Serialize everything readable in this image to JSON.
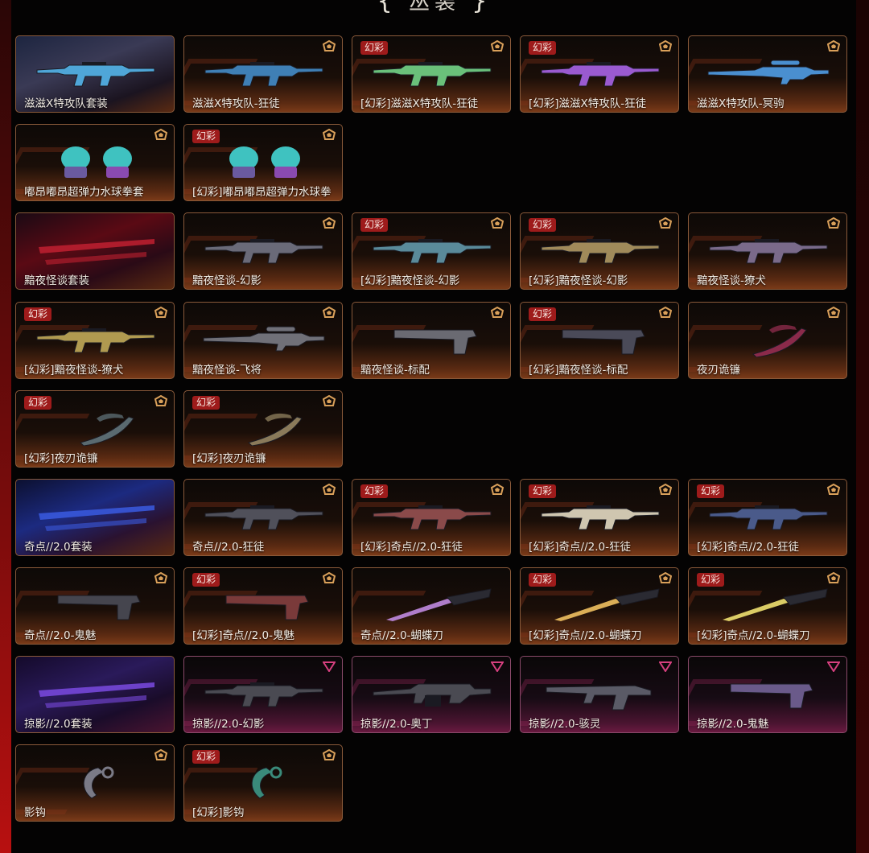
{
  "header": {
    "title": "丛装",
    "bracket_left": "{",
    "bracket_right": "}"
  },
  "colors": {
    "gold_tier": "#d9a05a",
    "purple_tier": "#d6407f",
    "badge_bg": "#9e1b1b",
    "label_text": "#f2ece4"
  },
  "items": [
    {
      "label": "滋滋X特攻队套装",
      "badge": "",
      "tier": "none",
      "kind": "bundle-blue-light",
      "weapon": "rifle",
      "row": 0,
      "col": 0,
      "weapon_color": "#4fa6d8"
    },
    {
      "label": "滋滋X特攻队-狂徒",
      "badge": "",
      "tier": "gold",
      "kind": "normal",
      "weapon": "rifle",
      "row": 0,
      "col": 1,
      "weapon_color": "#3f7fb5"
    },
    {
      "label": "[幻彩]滋滋X特攻队-狂徒",
      "badge": "幻彩",
      "tier": "gold",
      "kind": "normal",
      "weapon": "rifle",
      "row": 0,
      "col": 2,
      "weapon_color": "#6ac07a"
    },
    {
      "label": "[幻彩]滋滋X特攻队-狂徒",
      "badge": "幻彩",
      "tier": "gold",
      "kind": "normal",
      "weapon": "rifle",
      "row": 0,
      "col": 3,
      "weapon_color": "#9a5ad0"
    },
    {
      "label": "滋滋X特攻队-冥驹",
      "badge": "",
      "tier": "gold",
      "kind": "normal",
      "weapon": "sniper",
      "row": 0,
      "col": 4,
      "weapon_color": "#4a8fd0"
    },
    {
      "label": "嘟昂嘟昂超弹力水球拳套",
      "badge": "",
      "tier": "gold",
      "kind": "normal",
      "weapon": "gloves",
      "row": 1,
      "col": 0,
      "weapon_color": "#3fc2c0"
    },
    {
      "label": "[幻彩]嘟昂嘟昂超弹力水球拳",
      "badge": "幻彩",
      "tier": "gold",
      "kind": "normal",
      "weapon": "gloves",
      "row": 1,
      "col": 1,
      "weapon_color": "#3fc2c0"
    },
    {
      "label": "黯夜怪谈套装",
      "badge": "",
      "tier": "none",
      "kind": "bundle-red",
      "weapon": "bundle",
      "row": 2,
      "col": 0,
      "weapon_color": "#c02030"
    },
    {
      "label": "黯夜怪谈-幻影",
      "badge": "",
      "tier": "gold",
      "kind": "normal",
      "weapon": "rifle",
      "row": 2,
      "col": 1,
      "weapon_color": "#6a6a78"
    },
    {
      "label": "[幻彩]黯夜怪谈-幻影",
      "badge": "幻彩",
      "tier": "gold",
      "kind": "normal",
      "weapon": "rifle",
      "row": 2,
      "col": 2,
      "weapon_color": "#5a8a9a"
    },
    {
      "label": "[幻彩]黯夜怪谈-幻影",
      "badge": "幻彩",
      "tier": "gold",
      "kind": "normal",
      "weapon": "rifle",
      "row": 2,
      "col": 3,
      "weapon_color": "#a08a5a"
    },
    {
      "label": "黯夜怪谈-獠犬",
      "badge": "",
      "tier": "gold",
      "kind": "normal",
      "weapon": "rifle",
      "row": 2,
      "col": 4,
      "weapon_color": "#7a6a8a"
    },
    {
      "label": "[幻彩]黯夜怪谈-獠犬",
      "badge": "幻彩",
      "tier": "gold",
      "kind": "normal",
      "weapon": "rifle",
      "row": 3,
      "col": 0,
      "weapon_color": "#b09a50"
    },
    {
      "label": "黯夜怪谈-飞将",
      "badge": "",
      "tier": "gold",
      "kind": "normal",
      "weapon": "sniper",
      "row": 3,
      "col": 1,
      "weapon_color": "#707078"
    },
    {
      "label": "黯夜怪谈-标配",
      "badge": "",
      "tier": "gold",
      "kind": "normal",
      "weapon": "pistol",
      "row": 3,
      "col": 2,
      "weapon_color": "#6a6a72"
    },
    {
      "label": "[幻彩]黯夜怪谈-标配",
      "badge": "幻彩",
      "tier": "gold",
      "kind": "normal",
      "weapon": "pistol",
      "row": 3,
      "col": 3,
      "weapon_color": "#4a4a58"
    },
    {
      "label": "夜刃诡镰",
      "badge": "",
      "tier": "gold",
      "kind": "normal",
      "weapon": "scythe",
      "row": 3,
      "col": 4,
      "weapon_color": "#8a2a4a"
    },
    {
      "label": "[幻彩]夜刃诡镰",
      "badge": "幻彩",
      "tier": "gold",
      "kind": "normal",
      "weapon": "scythe",
      "row": 4,
      "col": 0,
      "weapon_color": "#5a6a70"
    },
    {
      "label": "[幻彩]夜刃诡镰",
      "badge": "幻彩",
      "tier": "gold",
      "kind": "normal",
      "weapon": "scythe",
      "row": 4,
      "col": 1,
      "weapon_color": "#8a7a5a"
    },
    {
      "label": "奇点//2.0套装",
      "badge": "",
      "tier": "none",
      "kind": "bundle-blue",
      "weapon": "bundle",
      "row": 5,
      "col": 0,
      "weapon_color": "#3a5ae0"
    },
    {
      "label": "奇点//2.0-狂徒",
      "badge": "",
      "tier": "gold",
      "kind": "normal",
      "weapon": "rifle",
      "row": 5,
      "col": 1,
      "weapon_color": "#50505a"
    },
    {
      "label": "[幻彩]奇点//2.0-狂徒",
      "badge": "幻彩",
      "tier": "gold",
      "kind": "normal",
      "weapon": "rifle",
      "row": 5,
      "col": 2,
      "weapon_color": "#8a4a4a"
    },
    {
      "label": "[幻彩]奇点//2.0-狂徒",
      "badge": "幻彩",
      "tier": "gold",
      "kind": "normal",
      "weapon": "rifle",
      "row": 5,
      "col": 3,
      "weapon_color": "#cfc6b0"
    },
    {
      "label": "[幻彩]奇点//2.0-狂徒",
      "badge": "幻彩",
      "tier": "gold",
      "kind": "normal",
      "weapon": "rifle",
      "row": 5,
      "col": 4,
      "weapon_color": "#4a5a8a"
    },
    {
      "label": "奇点//2.0-鬼魅",
      "badge": "",
      "tier": "gold",
      "kind": "normal",
      "weapon": "pistol",
      "row": 6,
      "col": 0,
      "weapon_color": "#45454e"
    },
    {
      "label": "[幻彩]奇点//2.0-鬼魅",
      "badge": "幻彩",
      "tier": "gold",
      "kind": "normal",
      "weapon": "pistol",
      "row": 6,
      "col": 1,
      "weapon_color": "#7a3a3a"
    },
    {
      "label": "奇点//2.0-蝴蝶刀",
      "badge": "",
      "tier": "none",
      "kind": "normal",
      "weapon": "knife",
      "row": 6,
      "col": 2,
      "weapon_color": "#c08ae0"
    },
    {
      "label": "[幻彩]奇点//2.0-蝴蝶刀",
      "badge": "幻彩",
      "tier": "gold",
      "kind": "normal",
      "weapon": "knife",
      "row": 6,
      "col": 3,
      "weapon_color": "#f0c060"
    },
    {
      "label": "[幻彩]奇点//2.0-蝴蝶刀",
      "badge": "幻彩",
      "tier": "gold",
      "kind": "normal",
      "weapon": "knife",
      "row": 6,
      "col": 4,
      "weapon_color": "#f0e070"
    },
    {
      "label": "掠影//2.0套装",
      "badge": "",
      "tier": "none",
      "kind": "bundle-violet",
      "weapon": "bundle",
      "row": 7,
      "col": 0,
      "weapon_color": "#7a4ae0"
    },
    {
      "label": "掠影//2.0-幻影",
      "badge": "",
      "tier": "purple",
      "kind": "purple",
      "weapon": "rifle",
      "row": 7,
      "col": 1,
      "weapon_color": "#4a4a52"
    },
    {
      "label": "掠影//2.0-奥丁",
      "badge": "",
      "tier": "purple",
      "kind": "purple",
      "weapon": "lmg",
      "row": 7,
      "col": 2,
      "weapon_color": "#4a4a52"
    },
    {
      "label": "掠影//2.0-骇灵",
      "badge": "",
      "tier": "purple",
      "kind": "purple",
      "weapon": "smg",
      "row": 7,
      "col": 3,
      "weapon_color": "#5a5a66"
    },
    {
      "label": "掠影//2.0-鬼魅",
      "badge": "",
      "tier": "purple",
      "kind": "purple",
      "weapon": "pistol",
      "row": 7,
      "col": 4,
      "weapon_color": "#6a5a8a"
    },
    {
      "label": "影钩",
      "badge": "",
      "tier": "gold",
      "kind": "normal",
      "weapon": "karambit",
      "row": 8,
      "col": 0,
      "weapon_color": "#7a7a86"
    },
    {
      "label": "[幻彩]影钩",
      "badge": "幻彩",
      "tier": "gold",
      "kind": "normal",
      "weapon": "karambit",
      "row": 8,
      "col": 1,
      "weapon_color": "#3a8a7a"
    }
  ]
}
